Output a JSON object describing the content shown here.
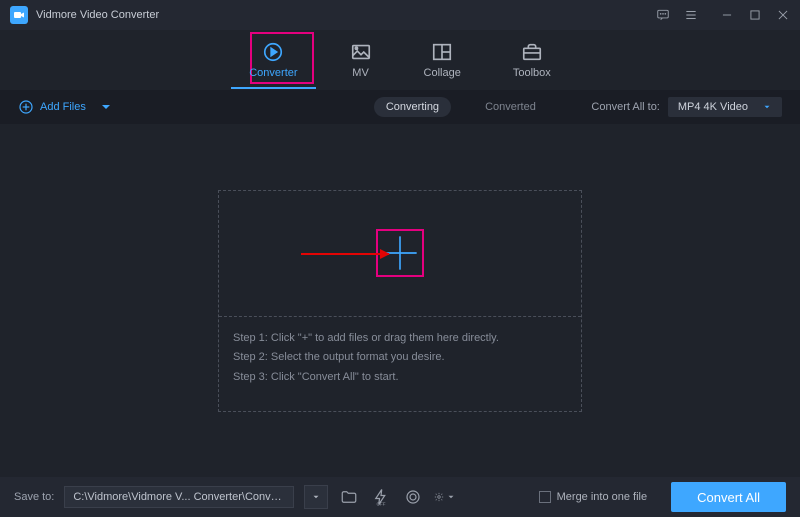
{
  "app": {
    "title": "Vidmore Video Converter"
  },
  "tabs": {
    "converter": "Converter",
    "mv": "MV",
    "collage": "Collage",
    "toolbox": "Toolbox"
  },
  "actionbar": {
    "add_files": "Add Files",
    "sub_converting": "Converting",
    "sub_converted": "Converted",
    "convert_all_to": "Convert All to:",
    "format_selected": "MP4 4K Video"
  },
  "dropzone": {
    "step1": "Step 1: Click \"+\" to add files or drag them here directly.",
    "step2": "Step 2: Select the output format you desire.",
    "step3": "Step 3: Click \"Convert All\" to start."
  },
  "bottom": {
    "save_to": "Save to:",
    "path": "C:\\Vidmore\\Vidmore V... Converter\\Converted",
    "merge": "Merge into one file",
    "convert_all": "Convert All"
  }
}
